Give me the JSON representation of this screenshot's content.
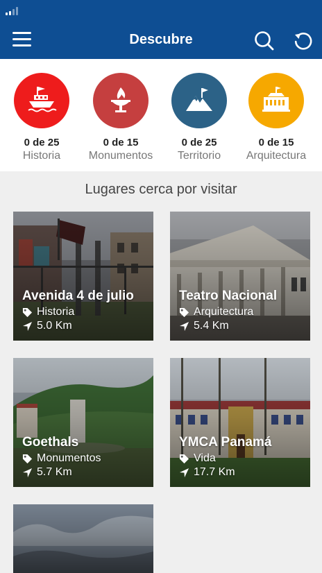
{
  "header": {
    "title": "Descubre",
    "icons": {
      "menu": "menu-icon",
      "search": "search-icon",
      "refresh": "refresh-icon"
    },
    "color": "#0e4e93"
  },
  "categories": [
    {
      "count": "0 de 25",
      "label": "Historia",
      "color": "#ee1c1c",
      "icon": "ship-icon"
    },
    {
      "count": "0 de 15",
      "label": "Monumentos",
      "color": "#c53f3f",
      "icon": "flame-monument-icon"
    },
    {
      "count": "0 de 25",
      "label": "Territorio",
      "color": "#2c6287",
      "icon": "mountain-flag-icon"
    },
    {
      "count": "0 de 15",
      "label": "Arquitectura",
      "color": "#f6a800",
      "icon": "building-icon"
    }
  ],
  "section": {
    "title": "Lugares cerca por visitar"
  },
  "places": [
    {
      "title": "Avenida 4 de julio",
      "category": "Historia",
      "distance": "5.0 Km"
    },
    {
      "title": "Teatro Nacional",
      "category": "Arquitectura",
      "distance": "5.4 Km"
    },
    {
      "title": "Goethals",
      "category": "Monumentos",
      "distance": "5.7 Km"
    },
    {
      "title": "YMCA Panamá",
      "category": "Vida",
      "distance": "17.7 Km"
    },
    {
      "title": "",
      "category": "",
      "distance": ""
    }
  ]
}
